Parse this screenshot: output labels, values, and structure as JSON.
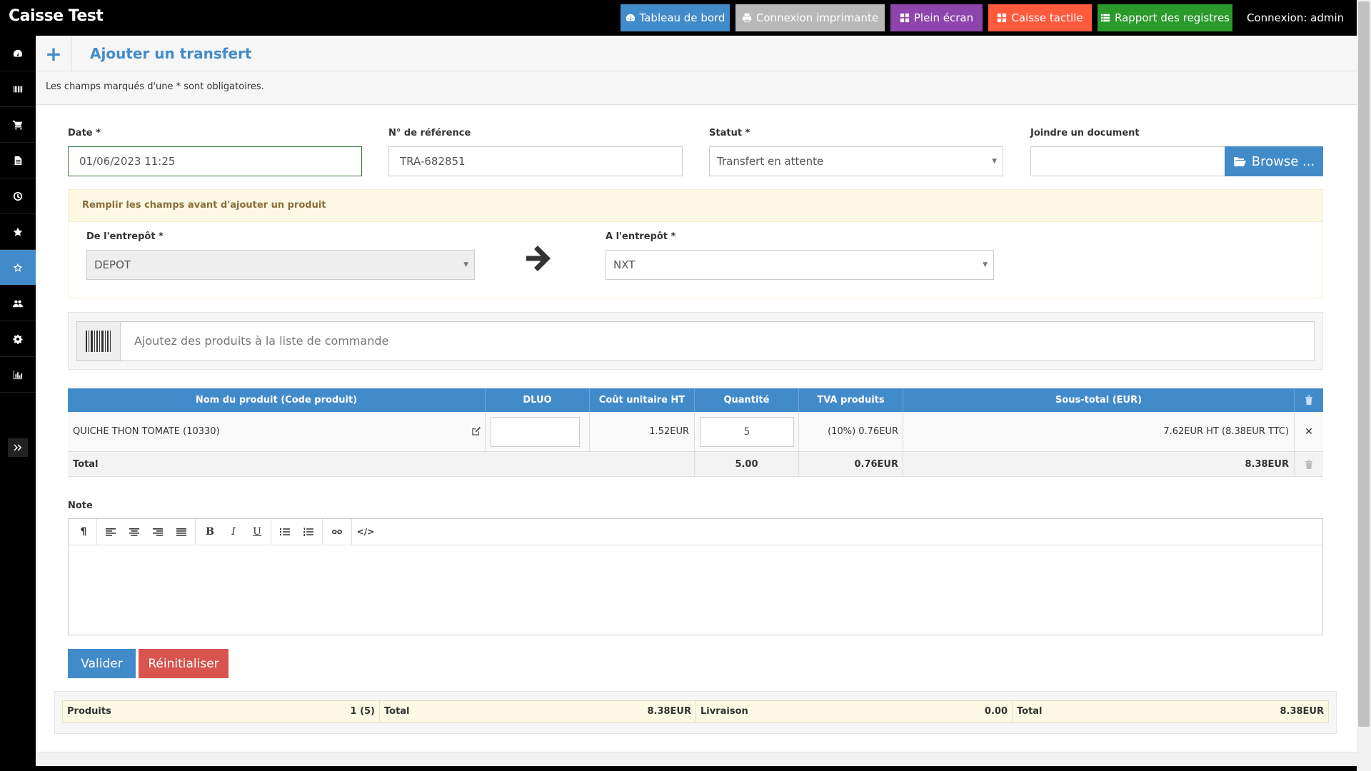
{
  "app": {
    "title": "Caisse Test"
  },
  "topbar": {
    "buttons": [
      {
        "label": "Tableau de bord",
        "icon": "dashboard-icon",
        "color": "#428bca"
      },
      {
        "label": "Connexion imprimante",
        "icon": "print-icon",
        "color": "#b8b8b8"
      },
      {
        "label": "Plein écran",
        "icon": "fullscreen-icon",
        "color": "#8e44ad"
      },
      {
        "label": "Caisse tactile",
        "icon": "pos-icon",
        "color": "#ff5a3c"
      },
      {
        "label": "Rapport des registres",
        "icon": "list-icon",
        "color": "#2a9a2a"
      }
    ],
    "login": "Connexion: admin"
  },
  "sidebar": {
    "items": [
      {
        "icon": "dashboard-icon"
      },
      {
        "icon": "barcode-icon"
      },
      {
        "icon": "shopping-cart-icon"
      },
      {
        "icon": "file-icon"
      },
      {
        "icon": "clock-icon"
      },
      {
        "icon": "star-icon"
      },
      {
        "icon": "star-outline-icon",
        "active": true
      },
      {
        "icon": "users-icon"
      },
      {
        "icon": "cogs-icon"
      },
      {
        "icon": "bar-chart-icon"
      }
    ],
    "toggle_icon": "double-chevron-right-icon"
  },
  "page": {
    "title": "Ajouter un transfert",
    "header_icon": "plus-icon",
    "intro": "Les champs marqués d'une * sont obligatoires."
  },
  "form": {
    "date": {
      "label": "Date *",
      "value": "01/06/2023 11:25"
    },
    "reference": {
      "label": "N° de référence",
      "value": "TRA-682851"
    },
    "status": {
      "label": "Statut *",
      "value": "Transfert en attente"
    },
    "document": {
      "label": "Joindre un document",
      "value": "",
      "browse_label": "Browse ..."
    },
    "warning": "Remplir les champs avant d'ajouter un produit",
    "from_warehouse": {
      "label": "De l'entrepôt *",
      "value": "DEPOT"
    },
    "to_warehouse": {
      "label": "A l'entrepôt *",
      "value": "NXT"
    },
    "add_product_placeholder": "Ajoutez des produits à la liste de commande"
  },
  "table": {
    "headers": [
      "Nom du produit (Code produit)",
      "DLUO",
      "Coût unitaire HT",
      "Quantité",
      "TVA produits",
      "Sous-total (EUR)"
    ],
    "rows": [
      {
        "name": "QUICHE THON TOMATE (10330)",
        "dluo": "",
        "unit_cost": "1.52EUR",
        "quantity": "5",
        "tax": "(10%) 0.76EUR",
        "subtotal": "7.62EUR HT (8.38EUR TTC)"
      }
    ],
    "footer": {
      "label": "Total",
      "quantity": "5.00",
      "tax": "0.76EUR",
      "subtotal": "8.38EUR"
    }
  },
  "note": {
    "label": "Note",
    "value": ""
  },
  "actions": {
    "submit": "Valider",
    "reset": "Réinitialiser"
  },
  "totals": {
    "products_label": "Produits",
    "products_value": "1 (5)",
    "total_label": "Total",
    "total_value": "8.38EUR",
    "shipping_label": "Livraison",
    "shipping_value": "0.00",
    "grand_total_label": "Total",
    "grand_total_value": "8.38EUR"
  }
}
